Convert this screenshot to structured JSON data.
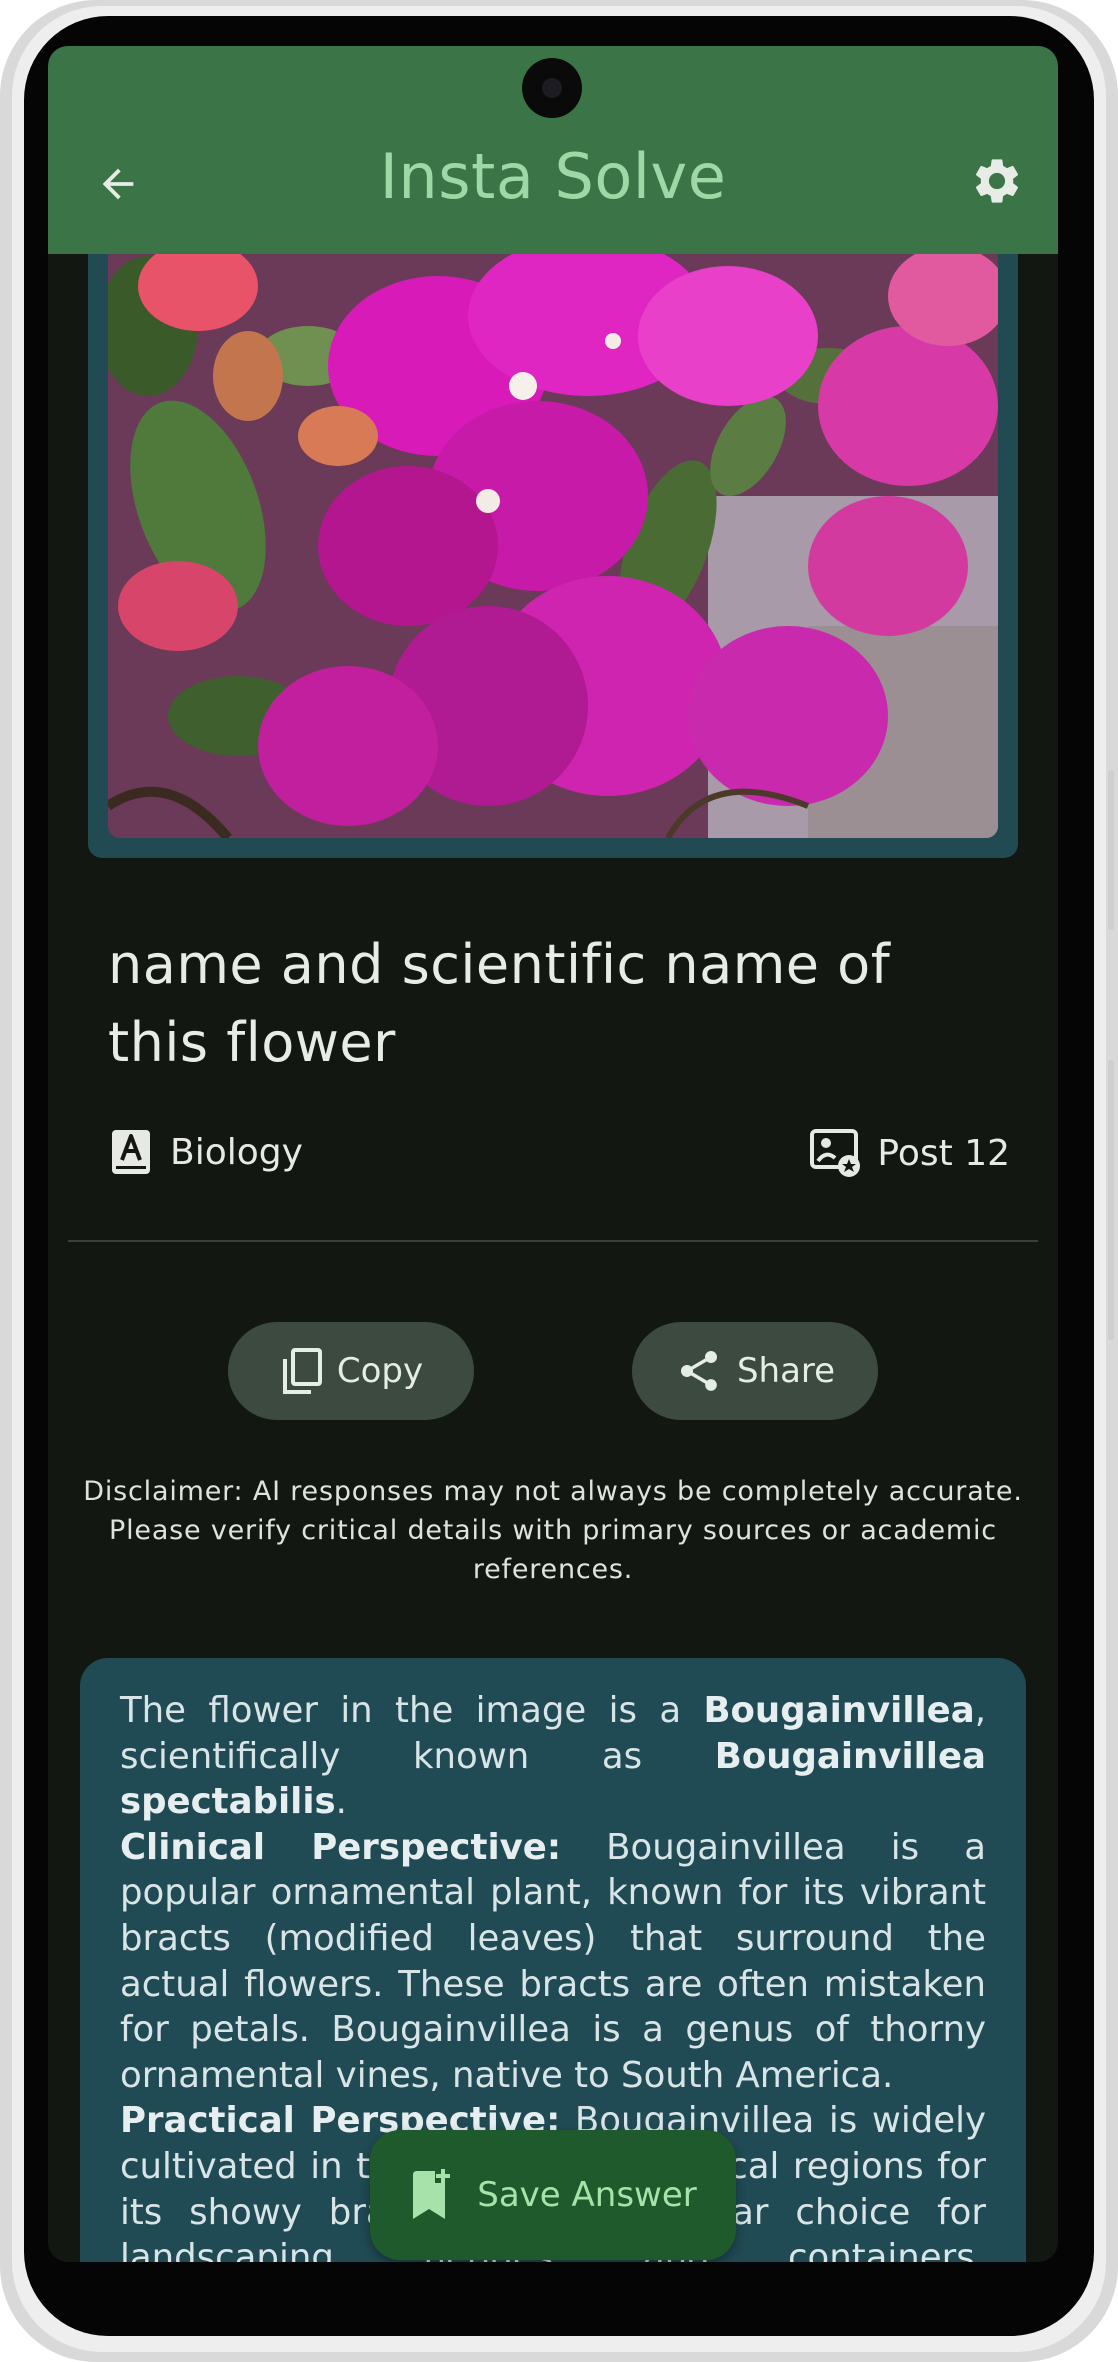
{
  "app": {
    "title": "Insta Solve",
    "back_icon": "arrow-left-icon",
    "settings_icon": "gear-icon"
  },
  "question": {
    "text": "name and scientific name of this flower",
    "subject_icon": "subject-book-icon",
    "subject": "Biology",
    "post_icon": "image-badge-icon",
    "post_label": "Post 12"
  },
  "actions": {
    "copy_label": "Copy",
    "share_label": "Share"
  },
  "disclaimer": {
    "line1": "Disclaimer: AI responses may not always be completely accurate.",
    "line2": "Please verify critical details with primary sources or academic",
    "line3": "references."
  },
  "answer": {
    "p1_a": "The flower in the image is a ",
    "p1_b": "Bougainvillea",
    "p1_c": ", scientifically known as ",
    "p1_d": "Bougainvillea spectabilis",
    "p1_e": ".",
    "p2_head": "Clinical Perspective:",
    "p2_body": " Bougainvillea is a popular ornamental plant, known for its vibrant bracts (modified leaves) that surround the actual flowers. These bracts are often mistaken for petals. Bougainvillea is a genus of thorny ornamental vines, native to South America.",
    "p3_head": "Practical Perspective:",
    "p3_body": " Bougainvillea is widely cultivated in tropical and subtropical regions for its showy bracts. It is a popular choice for landscaping, hedges, and containers. Bougainvillea is also known for its medicinal properties, with"
  },
  "fab": {
    "icon": "bookmark-add-icon",
    "label": "Save Answer"
  },
  "colors": {
    "appbar": "#3b7446",
    "background": "#131712",
    "answer_card": "#204a54",
    "fab": "#1f5a2c"
  }
}
